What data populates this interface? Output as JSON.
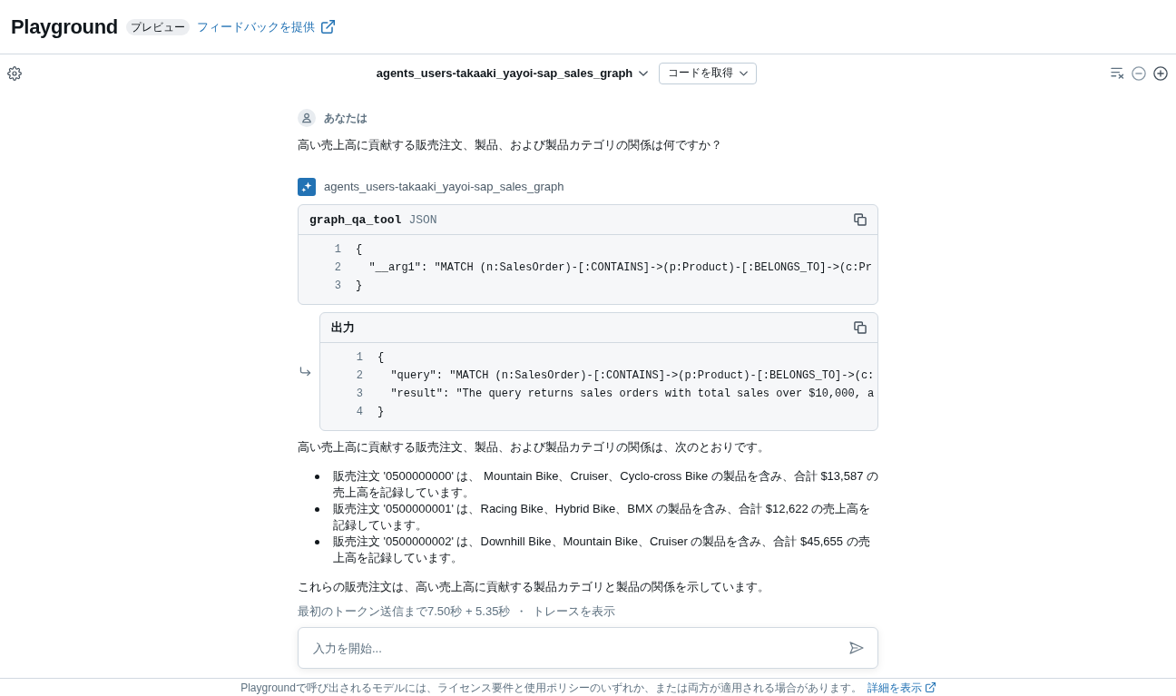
{
  "header": {
    "title": "Playground",
    "badge": "プレビュー",
    "feedback_link": "フィードバックを提供"
  },
  "toolbar": {
    "agent_selector": "agents_users-takaaki_yayoi-sap_sales_graph",
    "get_code_button": "コードを取得"
  },
  "conversation": {
    "user_message": {
      "author": "あなたは",
      "text": "高い売上高に貢献する販売注文、製品、および製品カテゴリの関係は何ですか？"
    },
    "assistant_message": {
      "author": "agents_users-takaaki_yayoi-sap_sales_graph",
      "tool_call": {
        "tool_name": "graph_qa_tool",
        "format": "JSON",
        "code_lines": [
          {
            "number": "1",
            "text": "{"
          },
          {
            "number": "2",
            "text": "  \"__arg1\": \"MATCH (n:SalesOrder)-[:CONTAINS]->(p:Product)-[:BELONGS_TO]->(c:Pr"
          },
          {
            "number": "3",
            "text": "}"
          }
        ]
      },
      "tool_output": {
        "title": "出力",
        "code_lines": [
          {
            "number": "1",
            "text": "{"
          },
          {
            "number": "2",
            "text": "  \"query\": \"MATCH (n:SalesOrder)-[:CONTAINS]->(p:Product)-[:BELONGS_TO]->(c:"
          },
          {
            "number": "3",
            "text": "  \"result\": \"The query returns sales orders with total sales over $10,000, a"
          },
          {
            "number": "4",
            "text": "}"
          }
        ]
      },
      "answer": {
        "intro": "高い売上高に貢献する販売注文、製品、および製品カテゴリの関係は、次のとおりです。",
        "bullets": [
          "販売注文 '0500000000' は、 Mountain Bike、Cruiser、Cyclo-cross Bike の製品を含み、合計 $13,587 の売上高を記録しています。",
          "販売注文 '0500000001' は、Racing Bike、Hybrid Bike、BMX の製品を含み、合計 $12,622 の売上高を記録しています。",
          "販売注文 '0500000002' は、Downhill Bike、Mountain Bike、Cruiser の製品を含み、合計 $45,655 の売上高を記録しています。"
        ],
        "conclusion": "これらの販売注文は、高い売上高に貢献する製品カテゴリと製品の関係を示しています。"
      },
      "metrics": {
        "timing": "最初のトークン送信まで7.50秒 + 5.35秒",
        "separator": "・",
        "trace_link": "トレースを表示"
      }
    }
  },
  "composer": {
    "placeholder": "入力を開始..."
  },
  "footer": {
    "notice": "Playgroundで呼び出されるモデルには、ライセンス要件と使用ポリシーのいずれか、または両方が適用される場合があります。",
    "details_link": "詳細を表示"
  }
}
